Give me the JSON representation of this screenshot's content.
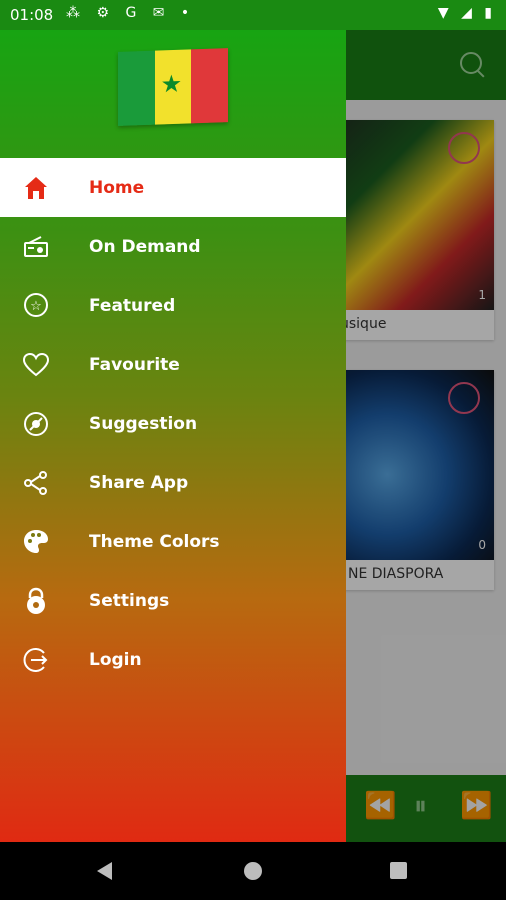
{
  "status": {
    "time": "01:08"
  },
  "drawer": {
    "items": [
      {
        "label": "Home",
        "icon": "home-icon",
        "active": true
      },
      {
        "label": "On Demand",
        "icon": "radio-icon"
      },
      {
        "label": "Featured",
        "icon": "star-badge-icon"
      },
      {
        "label": "Favourite",
        "icon": "heart-icon"
      },
      {
        "label": "Suggestion",
        "icon": "suggestion-icon"
      },
      {
        "label": "Share App",
        "icon": "share-icon"
      },
      {
        "label": "Theme Colors",
        "icon": "palette-icon"
      },
      {
        "label": "Settings",
        "icon": "settings-lock-icon"
      },
      {
        "label": "Login",
        "icon": "login-icon"
      }
    ]
  },
  "background": {
    "cards": [
      {
        "title": "usique",
        "views": "1"
      },
      {
        "title": "NE DIASPORA",
        "views": "0"
      }
    ]
  },
  "colors": {
    "active_text": "#e52b16",
    "drawer_top": "#17a412",
    "drawer_bottom": "#e02a12"
  }
}
